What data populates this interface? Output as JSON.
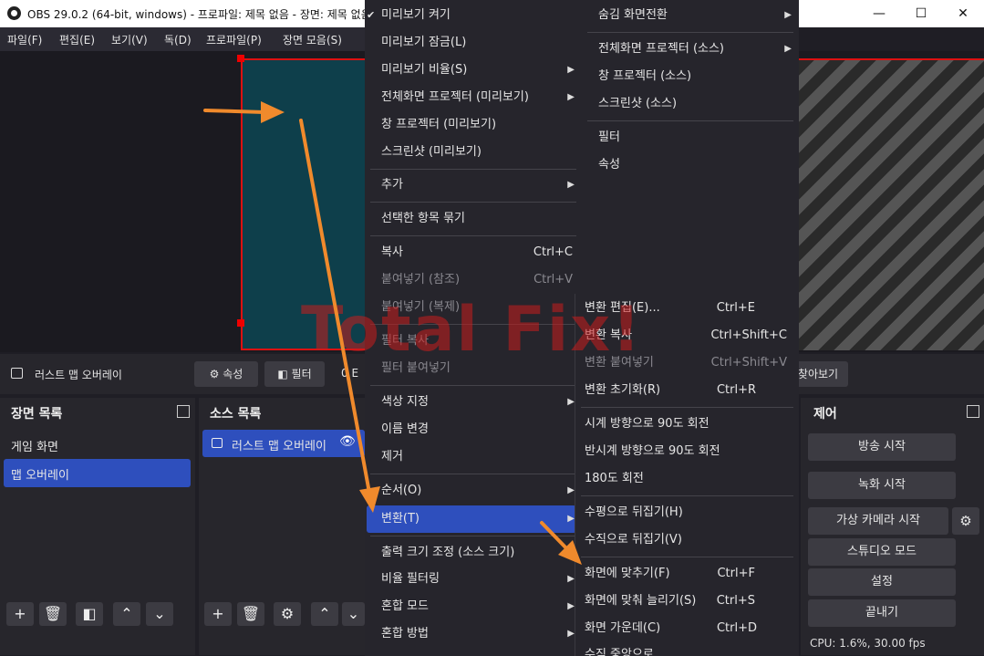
{
  "window": {
    "title": "OBS 29.0.2 (64-bit, windows) - 프로파일: 제목 없음 - 장면: 제목 없음",
    "minimize": "—",
    "maximize": "☐",
    "close": "✕"
  },
  "menubar": [
    "파일(F)",
    "편집(E)",
    "보기(V)",
    "독(D)",
    "프로파일(P)",
    "장면 모음(S)"
  ],
  "context_bar": {
    "source_name": "러스트 맵 오버레이",
    "properties": "속성",
    "filters": "필터",
    "trailing_left": "0 E",
    "trailing_right": "찾아보기"
  },
  "scenes_dock": {
    "title": "장면 목록",
    "items": [
      "게임 화면",
      "맵 오버레이"
    ],
    "selected": "맵 오버레이"
  },
  "sources_dock": {
    "title": "소스 목록",
    "items": [
      "러스트 맵 오버레이"
    ]
  },
  "controls_dock": {
    "title": "제어",
    "buttons": [
      "방송 시작",
      "녹화 시작",
      "가상 카메라 시작",
      "스튜디오 모드",
      "설정",
      "끝내기"
    ]
  },
  "status": "CPU: 1.6%, 30.00 fps",
  "watermark": "Total Fix!",
  "menu1": {
    "items": [
      {
        "label": "미리보기 켜기",
        "check": "✔"
      },
      {
        "label": "미리보기 잠금(L)"
      },
      {
        "label": "미리보기 비율(S)",
        "submenu": "▶"
      },
      {
        "label": "전체화면 프로젝터 (미리보기)",
        "submenu": "▶"
      },
      {
        "label": "창 프로젝터 (미리보기)"
      },
      {
        "label": "스크린샷 (미리보기)"
      },
      {
        "label": "추가",
        "submenu": "▶"
      },
      {
        "label": "선택한 항목 묶기"
      },
      {
        "label": "복사",
        "shortcut": "Ctrl+C"
      },
      {
        "label": "붙여넣기 (참조)",
        "shortcut": "Ctrl+V"
      },
      {
        "label": "붙여넣기 (복제)"
      },
      {
        "label": "필터 복사"
      },
      {
        "label": "필터 붙여넣기"
      },
      {
        "label": "색상 지정",
        "submenu": "▶"
      },
      {
        "label": "이름 변경"
      },
      {
        "label": "제거"
      },
      {
        "label": "순서(O)",
        "submenu": "▶"
      },
      {
        "label": "변환(T)",
        "submenu": "▶"
      },
      {
        "label": "출력 크기 조정 (소스 크기)"
      },
      {
        "label": "비율 필터링",
        "submenu": "▶"
      },
      {
        "label": "혼합 모드",
        "submenu": "▶"
      },
      {
        "label": "혼합 방법",
        "submenu": "▶"
      }
    ]
  },
  "menu2": {
    "items": [
      {
        "label": "숨김 화면전환",
        "submenu": "▶"
      },
      {
        "label": "전체화면 프로젝터 (소스)",
        "submenu": "▶"
      },
      {
        "label": "창 프로젝터 (소스)"
      },
      {
        "label": "스크린샷 (소스)"
      },
      {
        "label": "필터"
      },
      {
        "label": "속성"
      }
    ]
  },
  "menu3": {
    "items": [
      {
        "label": "변환 편집(E)...",
        "shortcut": "Ctrl+E"
      },
      {
        "label": "변환 복사",
        "shortcut": "Ctrl+Shift+C"
      },
      {
        "label": "변환 붙여넣기",
        "shortcut": "Ctrl+Shift+V"
      },
      {
        "label": "변환 초기화(R)",
        "shortcut": "Ctrl+R"
      },
      {
        "label": "시계 방향으로 90도 회전"
      },
      {
        "label": "반시계 방향으로 90도 회전"
      },
      {
        "label": "180도 회전"
      },
      {
        "label": "수평으로 뒤집기(H)"
      },
      {
        "label": "수직으로 뒤집기(V)"
      },
      {
        "label": "화면에 맞추기(F)",
        "shortcut": "Ctrl+F"
      },
      {
        "label": "화면에 맞춰 늘리기(S)",
        "shortcut": "Ctrl+S"
      },
      {
        "label": "화면 가운데(C)",
        "shortcut": "Ctrl+D"
      },
      {
        "label": "수직 중앙으로"
      }
    ]
  },
  "colors": {
    "accent": "#2e4fbd",
    "arrow": "#f08a2c",
    "selection_border": "#dd1111",
    "canvas": "#0e3f4b"
  }
}
